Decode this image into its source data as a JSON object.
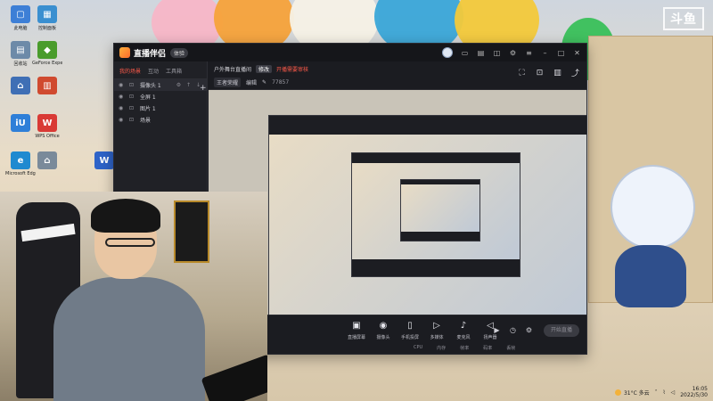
{
  "desktop": {
    "icons": [
      {
        "label": "此电脑",
        "glyph": "▢",
        "color": "#3d7fd6"
      },
      {
        "label": "控制面板",
        "glyph": "▦",
        "color": "#3a8fd0"
      },
      {
        "label": "回收站",
        "glyph": "▤",
        "color": "#6d8aa8"
      },
      {
        "label": "GeForce Experience",
        "glyph": "◆",
        "color": "#4a9c2c"
      },
      {
        "label": "",
        "glyph": "⌂",
        "color": "#3f6fb5"
      },
      {
        "label": "",
        "glyph": "▥",
        "color": "#d04a2f"
      },
      {
        "label": "",
        "glyph": "iU",
        "color": "#2f7fd8"
      },
      {
        "label": "WPS Office",
        "glyph": "W",
        "color": "#d93a35"
      },
      {
        "label": "Microsoft Edge",
        "glyph": "e",
        "color": "#1f8ad0"
      },
      {
        "label": "",
        "glyph": "⌂",
        "color": "#7a8a9a"
      },
      {
        "label": "",
        "glyph": "W",
        "color": "#2e63c8"
      }
    ]
  },
  "watermark": "斗鱼",
  "app": {
    "title": "直播伴侣",
    "version_badge": "体验",
    "scene_tabs": [
      "我的场景",
      "互动",
      "工具箱"
    ],
    "sources": [
      {
        "name": "摄像头 1",
        "selected": true
      },
      {
        "name": "全屏 1",
        "selected": false
      },
      {
        "name": "图片 1",
        "selected": false
      },
      {
        "name": "场景",
        "selected": false
      }
    ],
    "room_title": "户外舞台直播间",
    "room_tag": "修改",
    "room_warning": "开播需要审核",
    "category": "王者荣耀",
    "category_edit": "编辑",
    "viewer_count": "77857",
    "tools": [
      {
        "label": "直播屏幕",
        "icon": "screen-icon",
        "glyph": "▣"
      },
      {
        "label": "摄像头",
        "icon": "camera-icon",
        "glyph": "◉"
      },
      {
        "label": "手机投屏",
        "icon": "phone-icon",
        "glyph": "▯"
      },
      {
        "label": "多媒体",
        "icon": "media-icon",
        "glyph": "▷"
      },
      {
        "label": "麦克风",
        "icon": "mic-icon",
        "glyph": "♪"
      },
      {
        "label": "扬声器",
        "icon": "speaker-icon",
        "glyph": "◁"
      }
    ],
    "go_live_label": "开始直播",
    "status_items": [
      "CPU",
      "内存",
      "帧率",
      "码率",
      "丢帧"
    ]
  },
  "tray": {
    "weather": "31°C 多云",
    "time": "16:05",
    "date": "2022/5/30"
  },
  "colors": {
    "accent": "#ff5a4a",
    "window_bg": "#1b1c21",
    "panel_bg": "#202126"
  }
}
